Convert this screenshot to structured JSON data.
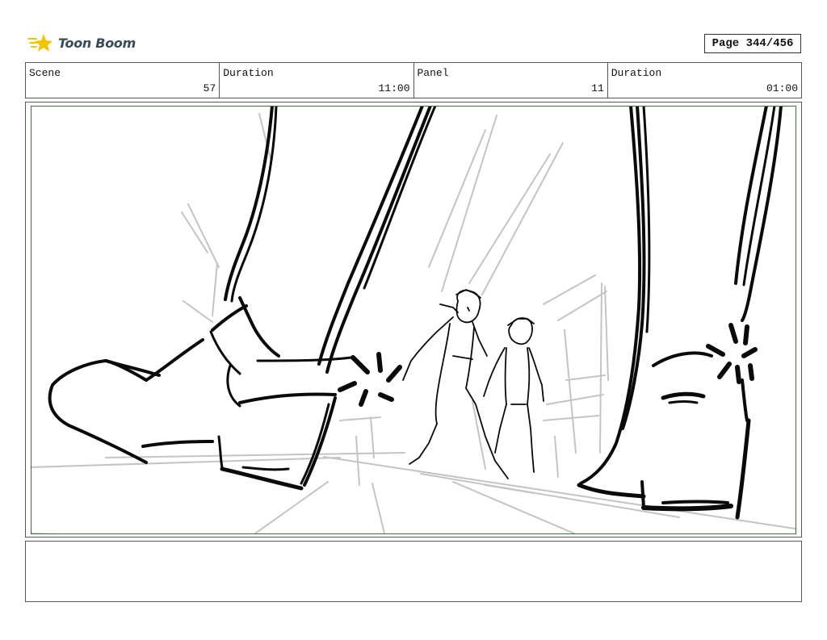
{
  "header": {
    "logo_text": "Toon Boom",
    "page_label": "Page 344/456"
  },
  "info": {
    "scene_label": "Scene",
    "scene_value": "57",
    "scene_duration_label": "Duration",
    "scene_duration_value": "11:00",
    "panel_label": "Panel",
    "panel_value": "11",
    "panel_duration_label": "Duration",
    "panel_duration_value": "01:00"
  },
  "panel": {
    "drawing": "sketch"
  },
  "notes": {
    "text": ""
  },
  "colors": {
    "frame_border": "#2f7a2f",
    "logo_star": "#f5c400"
  }
}
